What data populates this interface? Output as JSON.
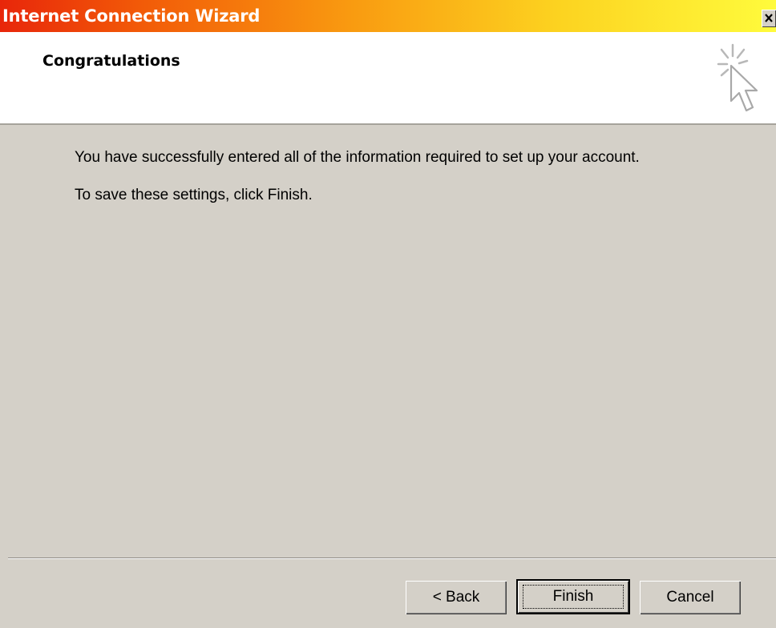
{
  "window": {
    "title": "Internet Connection Wizard",
    "close_icon": "close-icon"
  },
  "header": {
    "title": "Congratulations",
    "icon": "wizard-cursor-icon"
  },
  "body": {
    "line1": "You have successfully entered all of the information required to set up your account.",
    "line2": "To save these settings, click Finish."
  },
  "buttons": {
    "back": "< Back",
    "finish": "Finish",
    "cancel": "Cancel"
  },
  "colors": {
    "title_gradient_start": "#e8260a",
    "title_gradient_end": "#fffb3c",
    "dialog_face": "#d4d0c8",
    "header_bg": "#ffffff"
  }
}
